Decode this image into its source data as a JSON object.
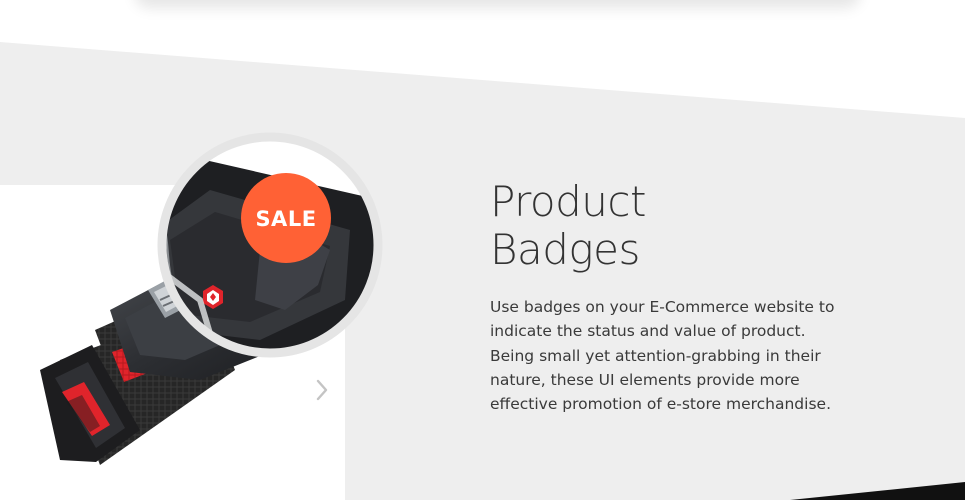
{
  "section": {
    "title_line1": "Product",
    "title_line2": "Badges",
    "description": "Use badges on your E-Commerce website to indicate the status and value of product. Being small yet attention-grabbing in their nature, these UI elements provide more effective promotion of e-store merchandise."
  },
  "badge": {
    "label": "SALE",
    "color": "#ff6135"
  },
  "slider": {
    "next_icon": "chevron-right-icon"
  },
  "colors": {
    "band": "#eeeeee",
    "magnifier_ring": "#e5e5e5",
    "strap": "#2a2a2a",
    "strap_stripe": "#e0242b",
    "corner": "#111111"
  }
}
